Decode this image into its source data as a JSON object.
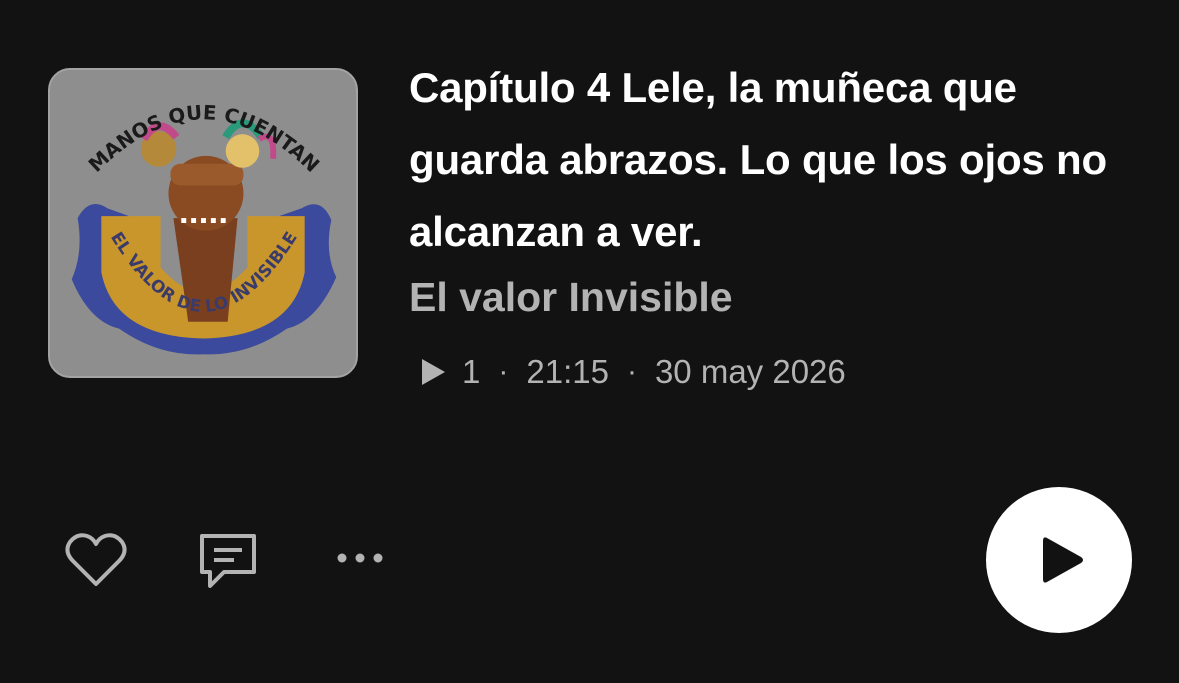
{
  "episode": {
    "cover_text_top": "MANOS QUE CUENTAN",
    "cover_text_bottom": "EL VALOR DE LO INVISIBLE",
    "title": "Capítulo 4 Lele, la muñeca que guarda abrazos. Lo que los ojos no alcanzan a ver.",
    "show": "El valor Invisible",
    "plays": "1",
    "separator": "·",
    "duration": "21:15",
    "date": "30 may 2026"
  },
  "icons": {
    "like": "heart-icon",
    "comment": "comment-icon",
    "more": "more-dots-icon",
    "play": "play-icon"
  },
  "colors": {
    "background": "#121212",
    "title": "#ffffff",
    "secondary": "#b3b3b3",
    "cover_band": "#c9962c",
    "cover_cloth": "#3b4a9c",
    "cover_arm": "#7a3f1e"
  }
}
